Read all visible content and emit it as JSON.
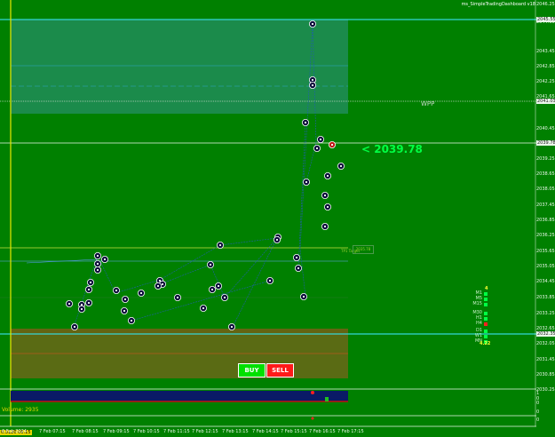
{
  "window": {
    "title": "ms_SimpleTradingDashboard v18"
  },
  "colors": {
    "background": "#008000",
    "zone_upper": "#1b8b4b",
    "zone_lower": "#5a6b14",
    "upper_line": "#33d6d6",
    "mid_line": "#33aacc",
    "wpp_line": "#c9d8c9",
    "price_line": "#e8f5e8",
    "buy": "#00e000",
    "sell": "#ff1a1a",
    "volume_panel": "#0a1a66"
  },
  "axis": {
    "prices": [
      "2046.25",
      "2044.05",
      "2043.45",
      "2042.85",
      "2042.25",
      "2041.65",
      "2040.45",
      "2039.85",
      "2039.25",
      "2038.65",
      "2038.05",
      "2037.45",
      "2036.85",
      "2036.25",
      "2035.65",
      "2035.05",
      "2034.45",
      "2033.85",
      "2033.25",
      "2032.65",
      "2032.05",
      "2031.45",
      "2030.85",
      "2030.25"
    ],
    "highlight_upper": "2045.55",
    "highlight_wpp": "2041.03",
    "highlight_price": "2039.78",
    "highlight_lower": "2032.35"
  },
  "volume_axis": [
    "1",
    "0",
    "0",
    "0",
    "0"
  ],
  "times": [
    "6 Feb 2024",
    "7 Feb 07:15",
    "7 Feb 08:15",
    "7 Feb 09:15",
    "7 Feb 10:15",
    "7 Feb 11:15",
    "7 Feb 12:15",
    "7 Feb 13:15",
    "7 Feb 14:15",
    "7 Feb 15:15",
    "7 Feb 16:15",
    "7 Feb 17:15"
  ],
  "labels": {
    "wpp": "WPP",
    "current_price": "<  2039.78",
    "tp_label": "TP1 Target",
    "tp_value": "2035.78",
    "volume": "Volume:  2935",
    "ask_tag": "0.3120 06:15"
  },
  "buttons": {
    "buy": "BUY",
    "sell": "SELL"
  },
  "timeframes": {
    "top_value": "4",
    "bottom_value": "4.22",
    "rows": [
      {
        "label": "M1",
        "state": "up"
      },
      {
        "label": "M5",
        "state": "up"
      },
      {
        "label": "M15",
        "state": "up"
      },
      {
        "label": "M30",
        "state": "up"
      },
      {
        "label": "H1",
        "state": "up"
      },
      {
        "label": "H4",
        "state": "down"
      },
      {
        "label": "D1",
        "state": "up"
      },
      {
        "label": "W1",
        "state": "up"
      },
      {
        "label": "MN",
        "state": "up"
      }
    ]
  }
}
